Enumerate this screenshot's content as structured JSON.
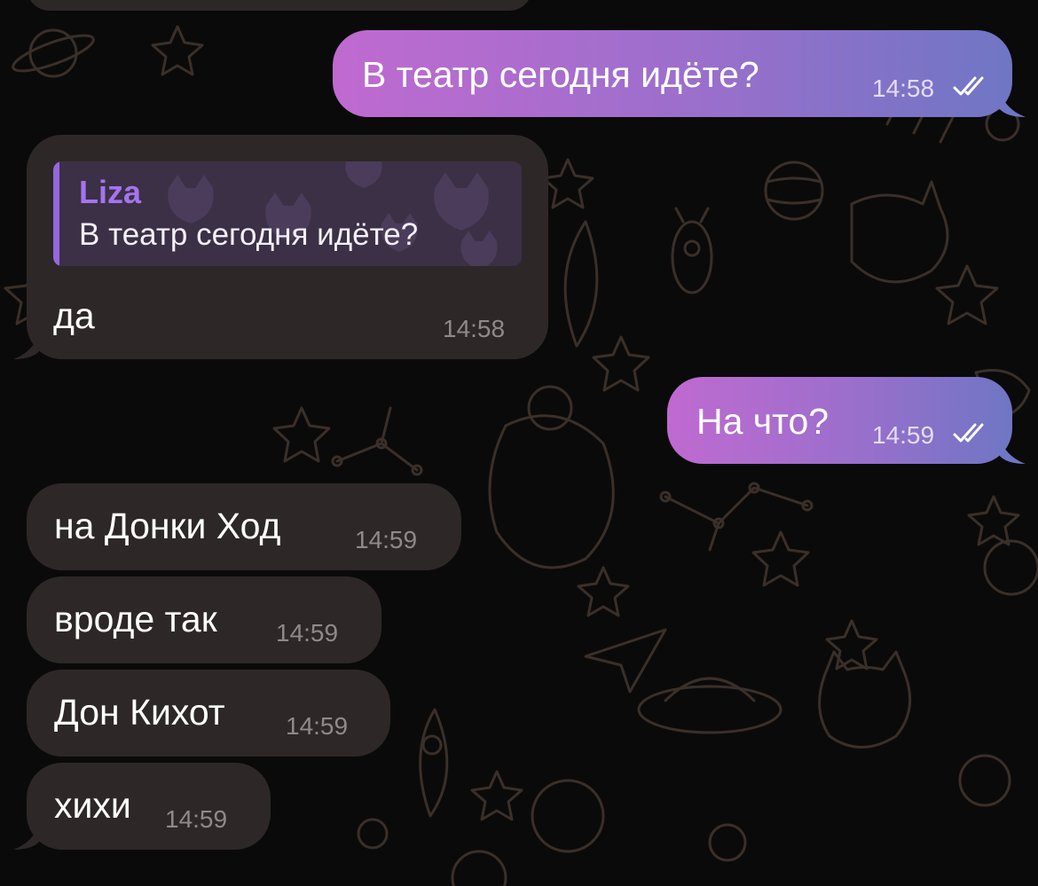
{
  "messages": [
    {
      "id": "m0",
      "direction": "incoming",
      "text": "",
      "time": ""
    },
    {
      "id": "m1",
      "direction": "outgoing",
      "text": "В театр сегодня идёте?",
      "time": "14:58",
      "status": "read"
    },
    {
      "id": "m2",
      "direction": "incoming",
      "text": "да",
      "time": "14:58",
      "reply_to": {
        "sender": "Liza",
        "text": "В театр сегодня идёте?"
      }
    },
    {
      "id": "m3",
      "direction": "outgoing",
      "text": "На что?",
      "time": "14:59",
      "status": "read"
    },
    {
      "id": "m4",
      "direction": "incoming",
      "text": "на Донки Ход",
      "time": "14:59"
    },
    {
      "id": "m5",
      "direction": "incoming",
      "text": "вроде так",
      "time": "14:59"
    },
    {
      "id": "m6",
      "direction": "incoming",
      "text": "Дон Кихот",
      "time": "14:59"
    },
    {
      "id": "m7",
      "direction": "incoming",
      "text": "хихи",
      "time": "14:59"
    }
  ],
  "colors": {
    "background": "#0b0a0a",
    "incoming_bubble": "#2d2827",
    "outgoing_gradient": [
      "#c06ad0",
      "#6f76c4"
    ],
    "reply_accent": "#a673ee",
    "wallpaper_lines": "#3a2f29"
  },
  "icons": {
    "read_status": "double-check-icon",
    "wallpaper": "space-doodle-pattern"
  }
}
